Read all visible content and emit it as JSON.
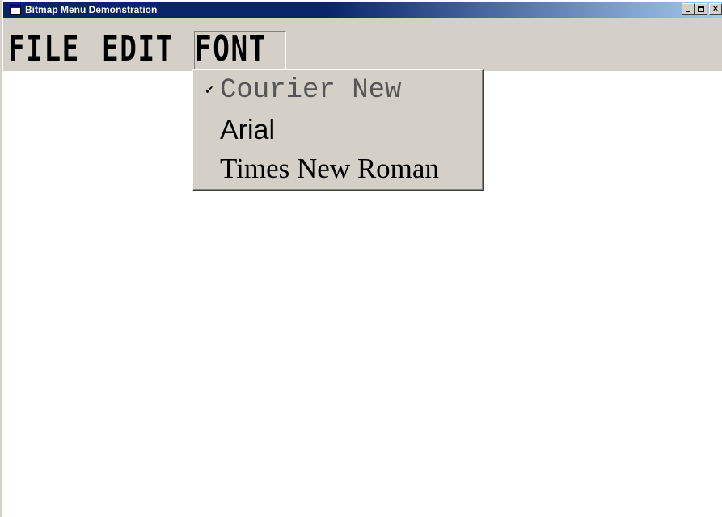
{
  "window": {
    "title": "Bitmap Menu Demonstration",
    "icon": "app-window-icon",
    "buttons": {
      "minimize_icon": "minimize-icon",
      "maximize_icon": "maximize-icon",
      "close_label": "×"
    }
  },
  "menubar": {
    "items": [
      {
        "label": "FILE"
      },
      {
        "label": "EDIT"
      },
      {
        "label": "FONT",
        "active": true
      }
    ]
  },
  "font_menu": {
    "items": [
      {
        "label": "Courier New",
        "checked": true,
        "check_glyph": "✔"
      },
      {
        "label": "Arial",
        "checked": false
      },
      {
        "label": "Times New Roman",
        "checked": false
      }
    ]
  },
  "colors": {
    "titlebar_start": "#0a246a",
    "titlebar_end": "#a6caf0",
    "face": "#d4d0c8",
    "client": "#ffffff"
  }
}
